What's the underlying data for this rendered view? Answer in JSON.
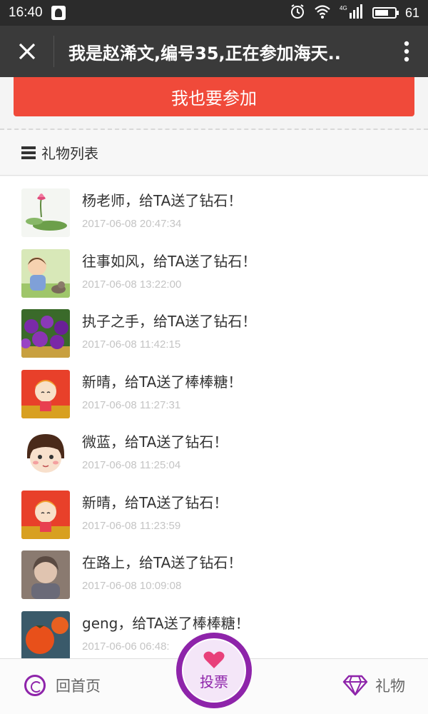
{
  "status_bar": {
    "time": "16:40",
    "network": "4G",
    "battery_level": "61"
  },
  "title_bar": {
    "title": "我是赵浠文,编号35,正在参加海天..",
    "close_icon": "close-icon",
    "more_icon": "more-vertical-icon"
  },
  "join_button": {
    "label": "我也要参加"
  },
  "gift_list": {
    "header_label": "礼物列表",
    "header_icon": "list-icon",
    "items": [
      {
        "text": "杨老师，给TA送了钻石！",
        "time": "2017-06-08 20:47:34"
      },
      {
        "text": "往事如风，给TA送了钻石！",
        "time": "2017-06-08 13:22:00"
      },
      {
        "text": "执子之手，给TA送了钻石！",
        "time": "2017-06-08 11:42:15"
      },
      {
        "text": "新晴，给TA送了棒棒糖！",
        "time": "2017-06-08 11:27:31"
      },
      {
        "text": "微蓝，给TA送了钻石！",
        "time": "2017-06-08 11:25:04"
      },
      {
        "text": "新晴，给TA送了钻石！",
        "time": "2017-06-08 11:23:59"
      },
      {
        "text": "在路上，给TA送了钻石！",
        "time": "2017-06-08 10:09:08"
      },
      {
        "text": "geng，给TA送了棒棒糖！",
        "time": "2017-06-06 06:48:"
      }
    ]
  },
  "bottom_bar": {
    "home_label": "回首页",
    "vote_label": "投票",
    "gift_label": "礼物"
  },
  "colors": {
    "accent": "#8e24aa",
    "join_button": "#f04a3a",
    "title_bar": "#3a3a3a"
  }
}
